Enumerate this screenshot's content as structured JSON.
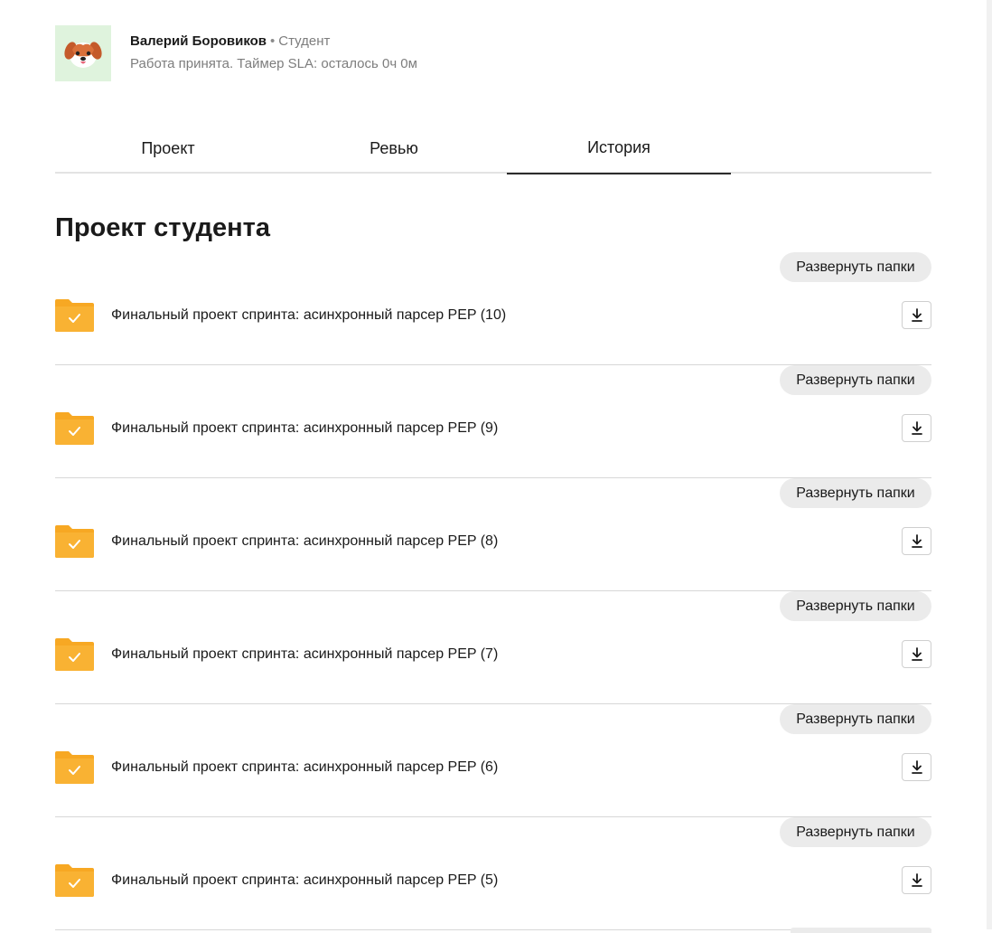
{
  "user": {
    "name": "Валерий Боровиков",
    "separator": "•",
    "role": "Студент",
    "status": "Работа принята. Таймер SLA: осталось 0ч 0м"
  },
  "tabs": [
    {
      "label": "Проект"
    },
    {
      "label": "Ревью"
    },
    {
      "label": "История",
      "active": true
    }
  ],
  "section": {
    "title": "Проект студента"
  },
  "projects": [
    {
      "name": "Финальный проект спринта: асинхронный парсер PEP (10)",
      "expand_label": "Развернуть папки"
    },
    {
      "name": "Финальный проект спринта: асинхронный парсер PEP (9)",
      "expand_label": "Развернуть папки"
    },
    {
      "name": "Финальный проект спринта: асинхронный парсер PEP (8)",
      "expand_label": "Развернуть папки"
    },
    {
      "name": "Финальный проект спринта: асинхронный парсер PEP (7)",
      "expand_label": "Развернуть папки"
    },
    {
      "name": "Финальный проект спринта: асинхронный парсер PEP (6)",
      "expand_label": "Развернуть папки"
    },
    {
      "name": "Финальный проект спринта: асинхронный парсер PEP (5)",
      "expand_label": "Развернуть папки"
    }
  ],
  "icons": {
    "folder": "folder-check-icon",
    "download": "download-icon",
    "avatar": "dog-avatar"
  },
  "colors": {
    "folder": "#f7a823",
    "active_tab_underline": "#2b2b2b",
    "pill_button": "#ebebeb"
  }
}
